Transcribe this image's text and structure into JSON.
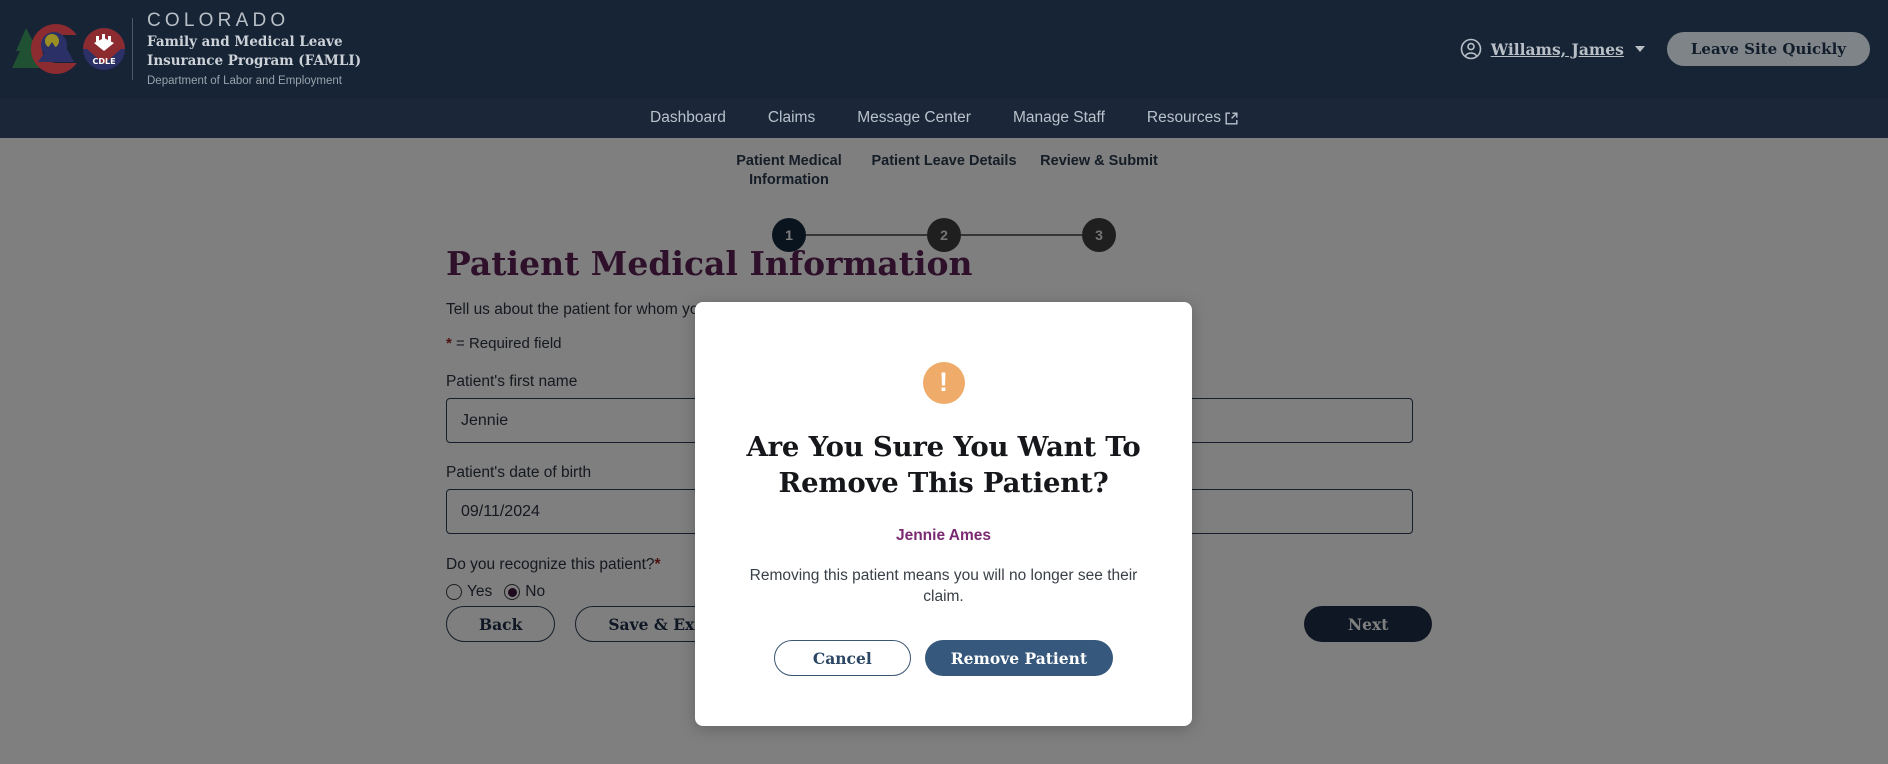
{
  "header": {
    "logo_icon": "colorado-cdle-logo",
    "state": "COLORADO",
    "program_line1": "Family and Medical Leave",
    "program_line2": "Insurance Program (FAMLI)",
    "department": "Department of Labor and Employment",
    "user_icon": "user-circle-icon",
    "user_name": "Willams, James",
    "caret_icon": "chevron-down-icon",
    "leave_site_label": "Leave Site Quickly",
    "bg_color": "#162436"
  },
  "nav": {
    "items": [
      {
        "label": "Dashboard",
        "external": false
      },
      {
        "label": "Claims",
        "external": false
      },
      {
        "label": "Message Center",
        "external": false
      },
      {
        "label": "Manage Staff",
        "external": false
      },
      {
        "label": "Resources",
        "external": true
      }
    ],
    "external_icon": "external-link-icon",
    "bg_color": "#1b2738"
  },
  "stepper": {
    "steps": [
      {
        "number": "1",
        "label": "Patient Medical Information",
        "active": true
      },
      {
        "number": "2",
        "label": "Patient Leave Details",
        "active": false
      },
      {
        "number": "3",
        "label": "Review & Submit",
        "active": false
      }
    ],
    "active_color": "#14283f",
    "inactive_color": "#3e3e3e"
  },
  "form": {
    "title": "Patient Medical Information",
    "subtitle": "Tell us about the patient for whom you are completing this form.",
    "required_star": "*",
    "required_note": " = Required field",
    "first_name_label": "Patient's first name",
    "first_name_value": "Jennie",
    "dob_label": "Patient's date of birth",
    "dob_value": "09/11/2024",
    "recognize_label": "Do you recognize this patient?",
    "recognize_required": "*",
    "radio_yes": "Yes",
    "radio_no": "No",
    "radio_selected": "No",
    "title_color": "#5c2054"
  },
  "footer_buttons": {
    "back_label": "Back",
    "save_exit_label": "Save & Exit",
    "next_label": "Next"
  },
  "modal": {
    "warning_icon": "exclamation-circle-icon",
    "warning_color": "#efab6a",
    "title": "Are You Sure You Want To Remove This Patient?",
    "patient_name": "Jennie Ames",
    "patient_name_color": "#7b2a72",
    "body": "Removing this patient means you will no longer see their claim.",
    "cancel_label": "Cancel",
    "confirm_label": "Remove Patient",
    "confirm_color": "#35587c"
  }
}
